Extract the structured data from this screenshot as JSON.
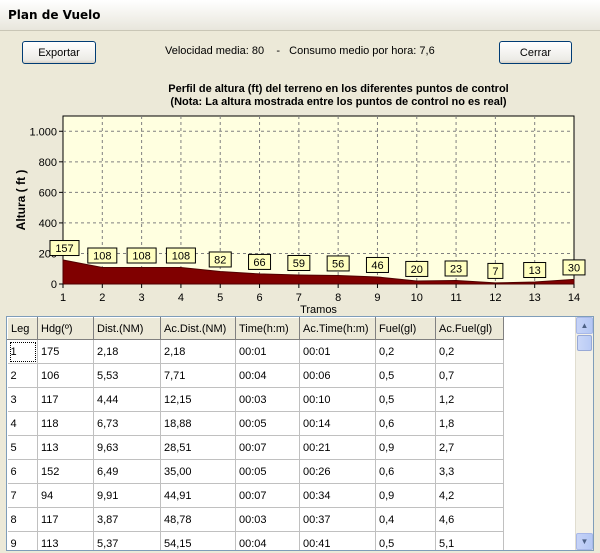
{
  "window": {
    "title": "Plan de Vuelo"
  },
  "toolbar": {
    "export_label": "Exportar",
    "close_label": "Cerrar",
    "avg_speed": "Velocidad media: 80",
    "separator": "-",
    "avg_consumption": "Consumo medio por hora: 7,6"
  },
  "chart_data": {
    "type": "area",
    "title": "Perfil de altura (ft) del terreno en los diferentes puntos de control",
    "subtitle": "(Nota: La altura mostrada entre los puntos de control no es real)",
    "xlabel": "Tramos",
    "ylabel": "Altura ( ft )",
    "x": [
      1,
      2,
      3,
      4,
      5,
      6,
      7,
      8,
      9,
      10,
      11,
      12,
      13,
      14
    ],
    "values": [
      157,
      108,
      108,
      108,
      82,
      66,
      59,
      56,
      46,
      20,
      23,
      7,
      13,
      30
    ],
    "value_labels": [
      "157",
      "108",
      "108",
      "108",
      "82",
      "66",
      "59",
      "56",
      "46",
      "20",
      "23",
      "7",
      "13",
      "30"
    ],
    "xlim": [
      1,
      14
    ],
    "ylim": [
      0,
      1100
    ],
    "yticks": [
      0,
      200,
      400,
      600,
      800,
      1000
    ],
    "ytick_labels": [
      "0",
      "200",
      "400",
      "600",
      "800",
      "1.000"
    ],
    "grid": true,
    "colors": {
      "fill": "#800000",
      "plot_bg": "#ffffe0",
      "label_bg": "#ffffc0",
      "grid": "#808080"
    }
  },
  "table": {
    "columns": [
      "Leg",
      "Hdg(º)",
      "Dist.(NM)",
      "Ac.Dist.(NM)",
      "Time(h:m)",
      "Ac.Time(h:m)",
      "Fuel(gl)",
      "Ac.Fuel(gl)"
    ],
    "rows": [
      [
        "1",
        "175",
        "2,18",
        "2,18",
        "00:01",
        "00:01",
        "0,2",
        "0,2"
      ],
      [
        "2",
        "106",
        "5,53",
        "7,71",
        "00:04",
        "00:06",
        "0,5",
        "0,7"
      ],
      [
        "3",
        "117",
        "4,44",
        "12,15",
        "00:03",
        "00:10",
        "0,5",
        "1,2"
      ],
      [
        "4",
        "118",
        "6,73",
        "18,88",
        "00:05",
        "00:14",
        "0,6",
        "1,8"
      ],
      [
        "5",
        "113",
        "9,63",
        "28,51",
        "00:07",
        "00:21",
        "0,9",
        "2,7"
      ],
      [
        "6",
        "152",
        "6,49",
        "35,00",
        "00:05",
        "00:26",
        "0,6",
        "3,3"
      ],
      [
        "7",
        "94",
        "9,91",
        "44,91",
        "00:07",
        "00:34",
        "0,9",
        "4,2"
      ],
      [
        "8",
        "117",
        "3,87",
        "48,78",
        "00:03",
        "00:37",
        "0,4",
        "4,6"
      ],
      [
        "9",
        "113",
        "5,37",
        "54,15",
        "00:04",
        "00:41",
        "0,5",
        "5,1"
      ]
    ]
  }
}
